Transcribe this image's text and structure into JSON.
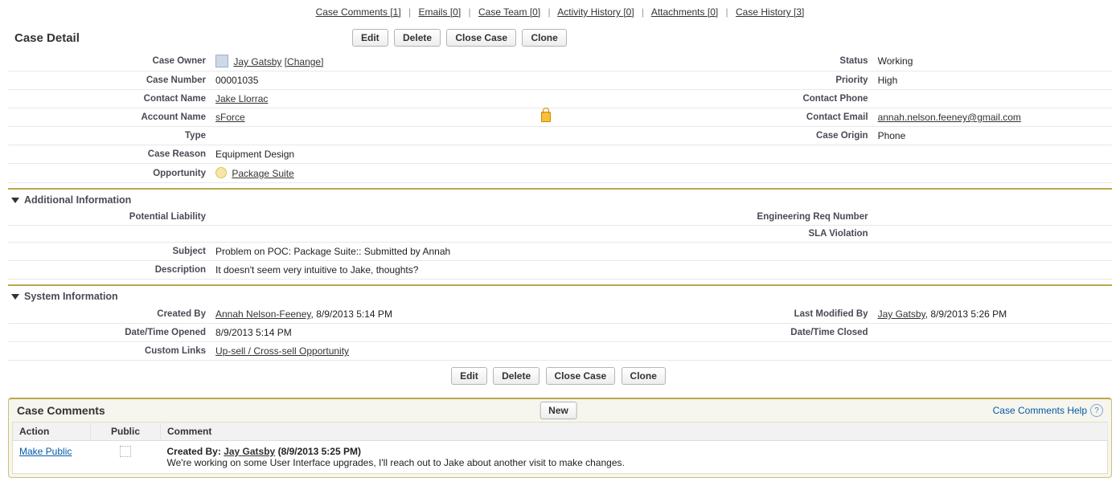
{
  "topLinks": [
    {
      "label": "Case Comments",
      "count": "[1]"
    },
    {
      "label": "Emails",
      "count": "[0]"
    },
    {
      "label": "Case Team",
      "count": "[0]"
    },
    {
      "label": "Activity History",
      "count": "[0]"
    },
    {
      "label": "Attachments",
      "count": "[0]"
    },
    {
      "label": "Case History",
      "count": "[3]"
    }
  ],
  "pageTitle": "Case Detail",
  "buttons": {
    "edit": "Edit",
    "delete": "Delete",
    "closeCase": "Close Case",
    "clone": "Clone",
    "new": "New"
  },
  "fields": {
    "caseOwnerLabel": "Case Owner",
    "caseOwnerValue": "Jay Gatsby",
    "changeLink": "[Change]",
    "statusLabel": "Status",
    "statusValue": "Working",
    "caseNumberLabel": "Case Number",
    "caseNumberValue": "00001035",
    "priorityLabel": "Priority",
    "priorityValue": "High",
    "contactNameLabel": "Contact Name",
    "contactNameValue": "Jake Llorrac",
    "contactPhoneLabel": "Contact Phone",
    "contactPhoneValue": "",
    "accountNameLabel": "Account Name",
    "accountNameValue": "sForce",
    "contactEmailLabel": "Contact Email",
    "contactEmailValue": "annah.nelson.feeney@gmail.com",
    "typeLabel": "Type",
    "typeValue": "",
    "caseOriginLabel": "Case Origin",
    "caseOriginValue": "Phone",
    "caseReasonLabel": "Case Reason",
    "caseReasonValue": "Equipment Design",
    "opportunityLabel": "Opportunity",
    "opportunityValue": "Package Suite"
  },
  "sections": {
    "additional": "Additional Information",
    "system": "System Information"
  },
  "additional": {
    "potentialLiabilityLabel": "Potential Liability",
    "engReqLabel": "Engineering Req Number",
    "slaLabel": "SLA Violation",
    "subjectLabel": "Subject",
    "subjectValue": "Problem on POC: Package Suite:: Submitted by Annah",
    "descriptionLabel": "Description",
    "descriptionValue": "It doesn't seem very intuitive to Jake, thoughts?"
  },
  "system": {
    "createdByLabel": "Created By",
    "createdByName": "Annah Nelson-Feeney",
    "createdByDate": ", 8/9/2013 5:14 PM",
    "lastModLabel": "Last Modified By",
    "lastModName": "Jay Gatsby",
    "lastModDate": ", 8/9/2013 5:26 PM",
    "openedLabel": "Date/Time Opened",
    "openedValue": "8/9/2013 5:14 PM",
    "closedLabel": "Date/Time Closed",
    "closedValue": "",
    "customLinksLabel": "Custom Links",
    "customLinksValue": "Up-sell / Cross-sell Opportunity"
  },
  "related": {
    "title": "Case Comments",
    "helpLabel": "Case Comments Help",
    "cols": {
      "action": "Action",
      "public": "Public",
      "comment": "Comment"
    },
    "row": {
      "actionLink": "Make Public",
      "createdByPrefix": "Created By: ",
      "createdByName": "Jay Gatsby",
      "createdByStamp": " (8/9/2013 5:25 PM)",
      "body": "We're working on some User Interface upgrades, I'll reach out to Jake about another visit to make changes."
    }
  }
}
